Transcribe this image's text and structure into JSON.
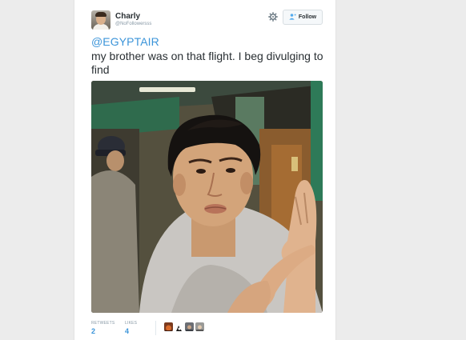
{
  "tweet": {
    "author": {
      "display_name": "Charly",
      "handle": "@NoFollowersss"
    },
    "follow_label": "Follow",
    "mention": "@EGYPTAIR",
    "text": "my brother was on that flight. I beg divulging to find",
    "stats": {
      "retweets_label": "RETWEETS",
      "retweets_count": "2",
      "likes_label": "LIKES",
      "likes_count": "4"
    }
  },
  "icons": {
    "more": "gear-icon",
    "follow": "person-add-icon"
  },
  "colors": {
    "link": "#3b94d9",
    "text": "#292f33",
    "muted": "#8899a6"
  }
}
